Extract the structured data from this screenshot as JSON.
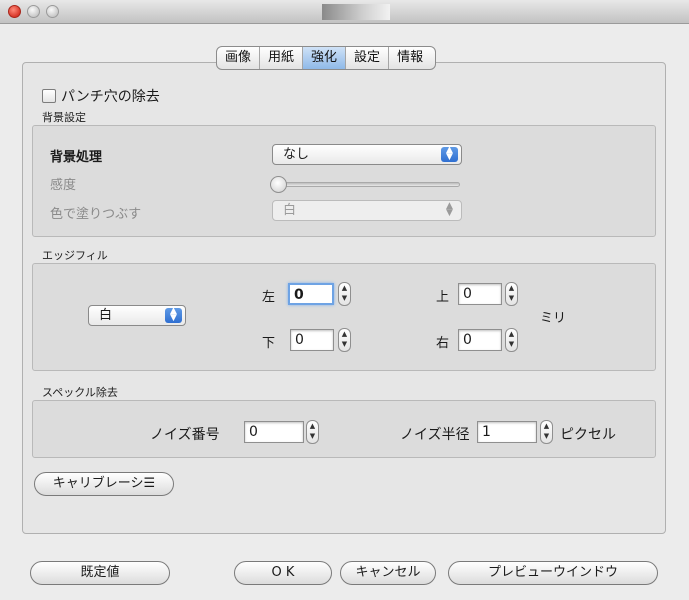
{
  "tabs": [
    "画像",
    "用紙",
    "強化",
    "設定",
    "情報"
  ],
  "active_tab_index": 2,
  "punch_hole": {
    "label": "パンチ穴の除去",
    "checked": false
  },
  "background": {
    "section_label": "背景設定",
    "processing_label": "背景処理",
    "processing_value": "なし",
    "sensitivity_label": "感度",
    "sensitivity_level": 0,
    "fill_label": "色で塗りつぶす",
    "fill_value": "白"
  },
  "edge_fill": {
    "section_label": "エッジフィル",
    "color_value": "白",
    "left_label": "左",
    "left_value": "0",
    "top_label": "上",
    "top_value": "0",
    "bottom_label": "下",
    "bottom_value": "0",
    "right_label": "右",
    "right_value": "0",
    "unit_label": "ミリ"
  },
  "speckle": {
    "section_label": "スペックル除去",
    "noise_number_label": "ノイズ番号",
    "noise_number_value": "0",
    "noise_radius_label": "ノイズ半径",
    "noise_radius_value": "1",
    "unit_label": "ピクセル"
  },
  "calibration_button": "キャリブレーシ☰",
  "buttons": {
    "default": "既定値",
    "ok": "O K",
    "cancel": "キャンセル",
    "preview": "プレビューウインドウ"
  },
  "stepper_glyph": "▲\n▼",
  "popup_glyph": "▲\n▼"
}
